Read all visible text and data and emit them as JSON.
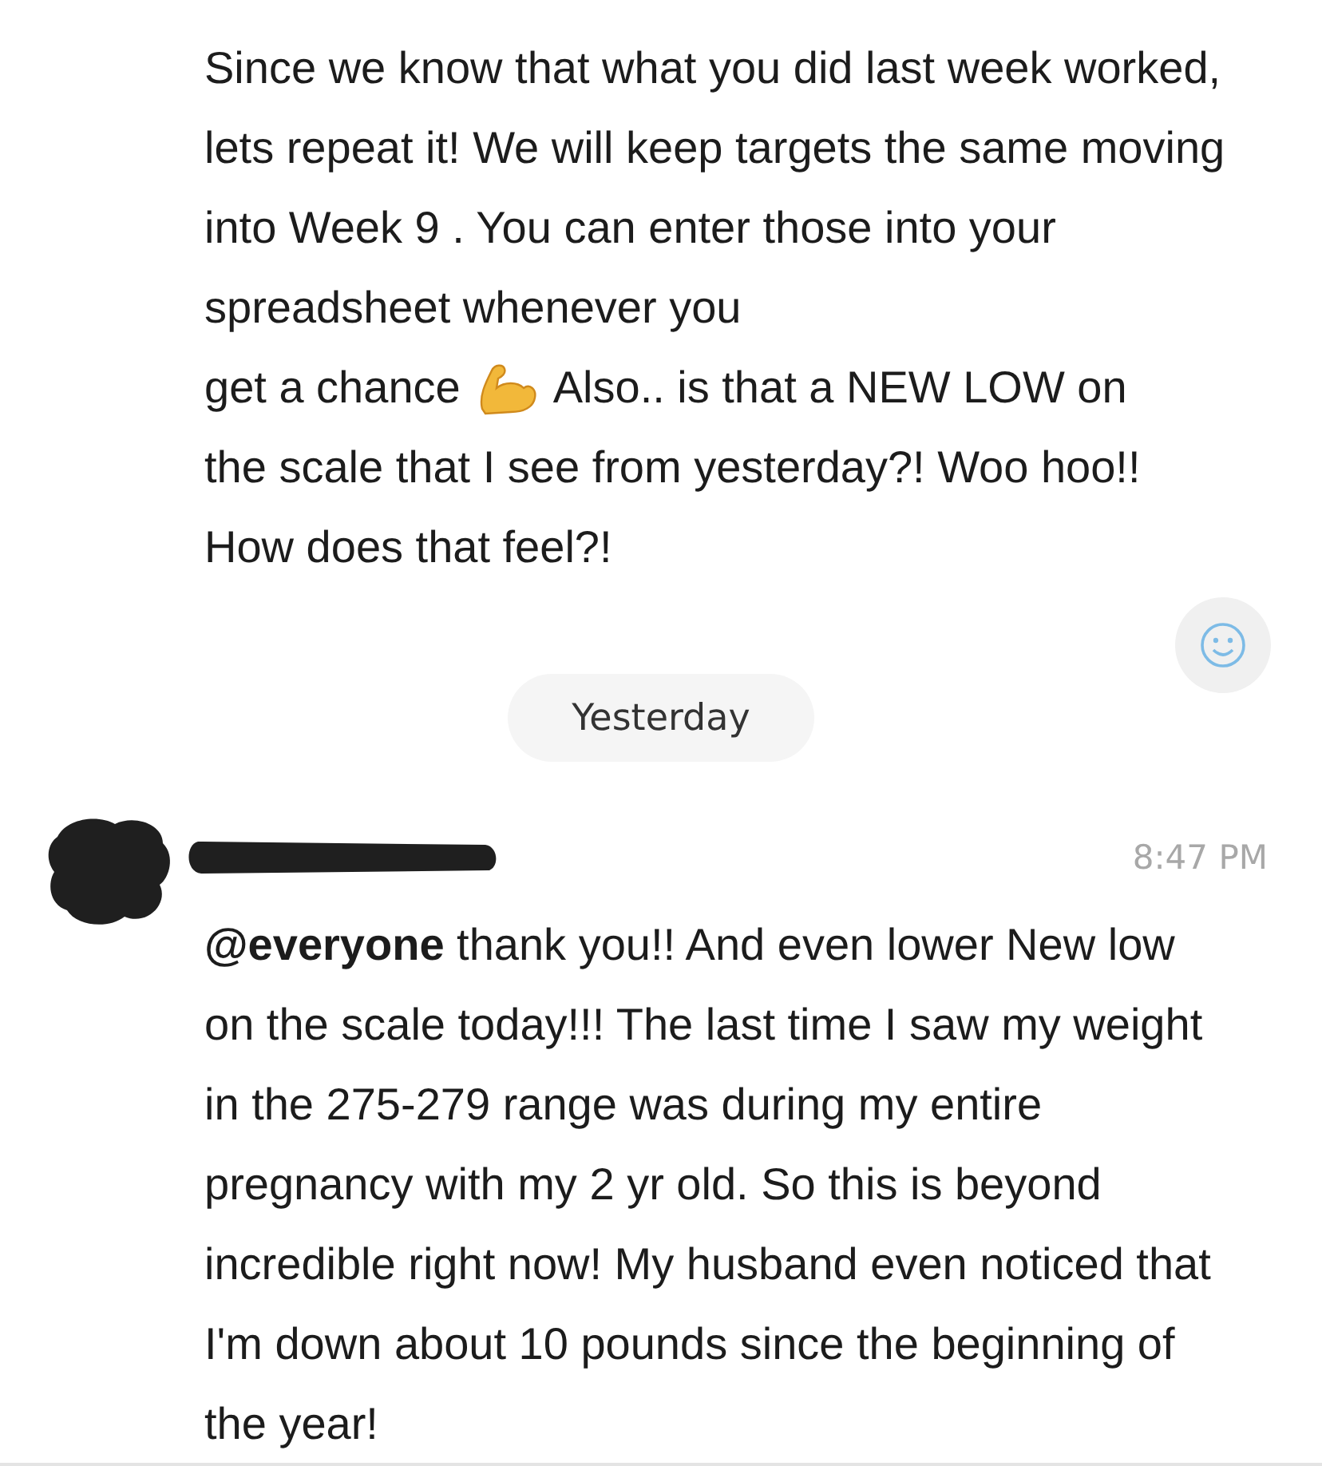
{
  "messages": [
    {
      "kind": "continued",
      "text_start": "Since we know that what you did last week worked, lets repeat it! We will keep targets the same moving into Week 9 . You can enter those into your spreadsheet whenever you",
      "before_icon": "get a chance",
      "after_icon": "Also.. is that a NEW LOW on",
      "text_end": "the scale that I see from yesterday?! Woo hoo!! How does that feel?!"
    },
    {
      "kind": "divider",
      "label": "Yesterday"
    },
    {
      "kind": "full",
      "time": "8:47 PM",
      "text": "**@everyone** thank you!! And even lower New low on the scale today!!! The last time I saw my weight in the 275-279 range was during my entire pregnancy with my 2 yr old. So this is beyond incredible right now! My husband even noticed that I'm down about 10 pounds since the beginning of the year!"
    }
  ]
}
